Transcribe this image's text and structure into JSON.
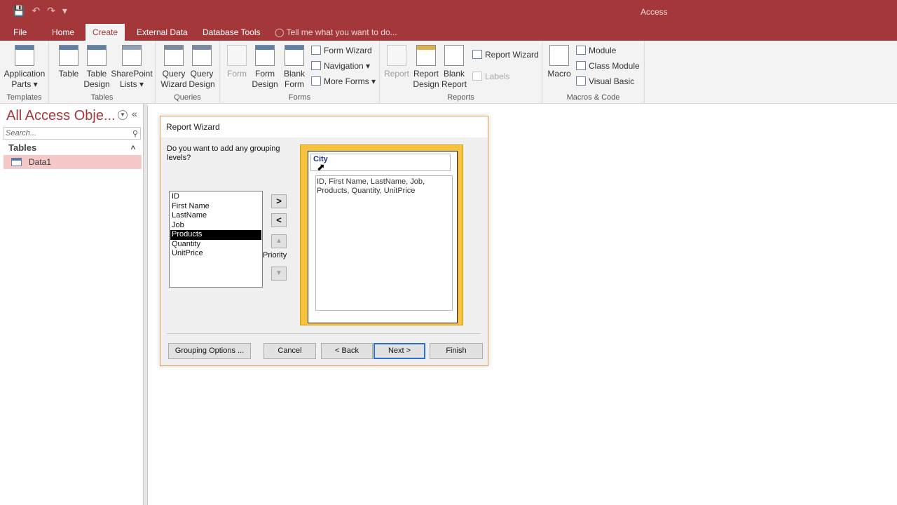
{
  "app": {
    "title": "Access"
  },
  "tabs": [
    "File",
    "Home",
    "Create",
    "External Data",
    "Database Tools"
  ],
  "tell_me": "Tell me what you want to do...",
  "ribbon": {
    "groups": {
      "templates": "Templates",
      "tables": "Tables",
      "queries": "Queries",
      "forms": "Forms",
      "reports": "Reports",
      "macros": "Macros & Code"
    },
    "buttons": {
      "application_parts": "Application",
      "application_parts_2": "Parts",
      "table": "Table",
      "table_design": "Table",
      "table_design_2": "Design",
      "sharepoint_lists": "SharePoint",
      "sharepoint_lists_2": "Lists",
      "query_wizard": "Query",
      "query_wizard_2": "Wizard",
      "query_design": "Query",
      "query_design_2": "Design",
      "form": "Form",
      "form_design": "Form",
      "form_design_2": "Design",
      "blank_form": "Blank",
      "blank_form_2": "Form",
      "form_wizard": "Form Wizard",
      "navigation": "Navigation",
      "more_forms": "More Forms",
      "report": "Report",
      "report_design": "Report",
      "report_design_2": "Design",
      "blank_report": "Blank",
      "blank_report_2": "Report",
      "report_wizard": "Report Wizard",
      "labels": "Labels",
      "macro": "Macro",
      "module": "Module",
      "class_module": "Class Module",
      "visual_basic": "Visual Basic"
    }
  },
  "nav": {
    "title": "All Access Obje...",
    "search_placeholder": "Search...",
    "section": "Tables",
    "items": [
      "Data1"
    ]
  },
  "dialog": {
    "title": "Report Wizard",
    "question": "Do you want to add any grouping levels?",
    "fields": [
      "ID",
      "First Name",
      "LastName",
      "Job",
      "Products",
      "Quantity",
      "UnitPrice"
    ],
    "selected_field": "Products",
    "add_label": ">",
    "remove_label": "<",
    "priority_label": "Priority",
    "preview_group": "City",
    "preview_detail": "ID, First Name, LastName, Job, Products, Quantity, UnitPrice",
    "buttons": {
      "grouping_options": "Grouping Options ...",
      "cancel": "Cancel",
      "back": "< Back",
      "next": "Next >",
      "finish": "Finish"
    }
  }
}
